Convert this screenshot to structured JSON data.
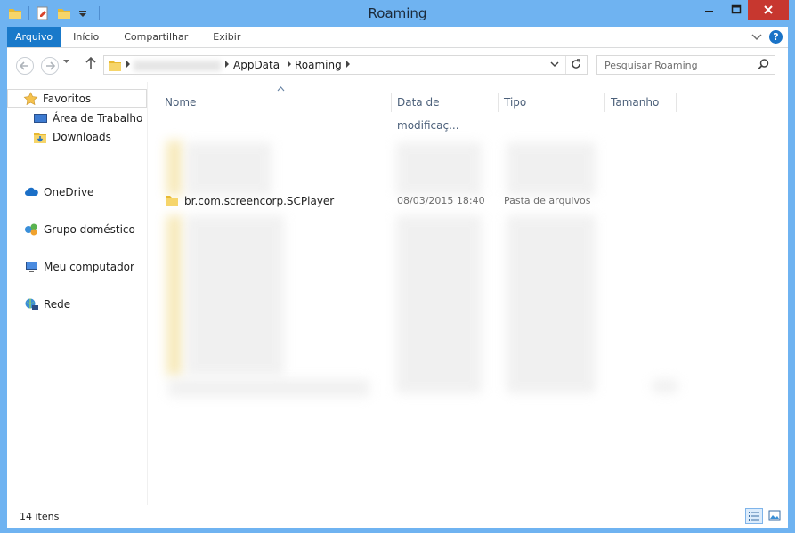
{
  "window": {
    "title": "Roaming"
  },
  "ribbon": {
    "tabs": [
      {
        "label": "Arquivo"
      },
      {
        "label": "Início"
      },
      {
        "label": "Compartilhar"
      },
      {
        "label": "Exibir"
      }
    ],
    "help": "?"
  },
  "address": {
    "crumbs": [
      "AppData",
      "Roaming"
    ],
    "search_placeholder": "Pesquisar Roaming"
  },
  "navpane": {
    "items": [
      {
        "label": "Favoritos",
        "icon": "star-icon"
      },
      {
        "label": "Área de Trabalho",
        "icon": "desktop-icon"
      },
      {
        "label": "Downloads",
        "icon": "downloads-folder-icon"
      },
      {
        "label": "OneDrive",
        "icon": "onedrive-cloud-icon"
      },
      {
        "label": "Grupo doméstico",
        "icon": "homegroup-icon"
      },
      {
        "label": "Meu computador",
        "icon": "computer-icon"
      },
      {
        "label": "Rede",
        "icon": "network-icon"
      }
    ]
  },
  "list": {
    "columns": [
      {
        "label": "Nome"
      },
      {
        "label": "Data de modificaç..."
      },
      {
        "label": "Tipo"
      },
      {
        "label": "Tamanho"
      }
    ],
    "rows": [
      {
        "name": "br.com.screencorp.SCPlayer",
        "date": "08/03/2015 18:40",
        "type": "Pasta de arquivos",
        "size": ""
      }
    ]
  },
  "status": {
    "count": "14 itens"
  },
  "colors": {
    "frame": "#6fb3f1",
    "file_tab": "#1979ca",
    "close": "#c7372f",
    "folder": "#e8b931"
  }
}
